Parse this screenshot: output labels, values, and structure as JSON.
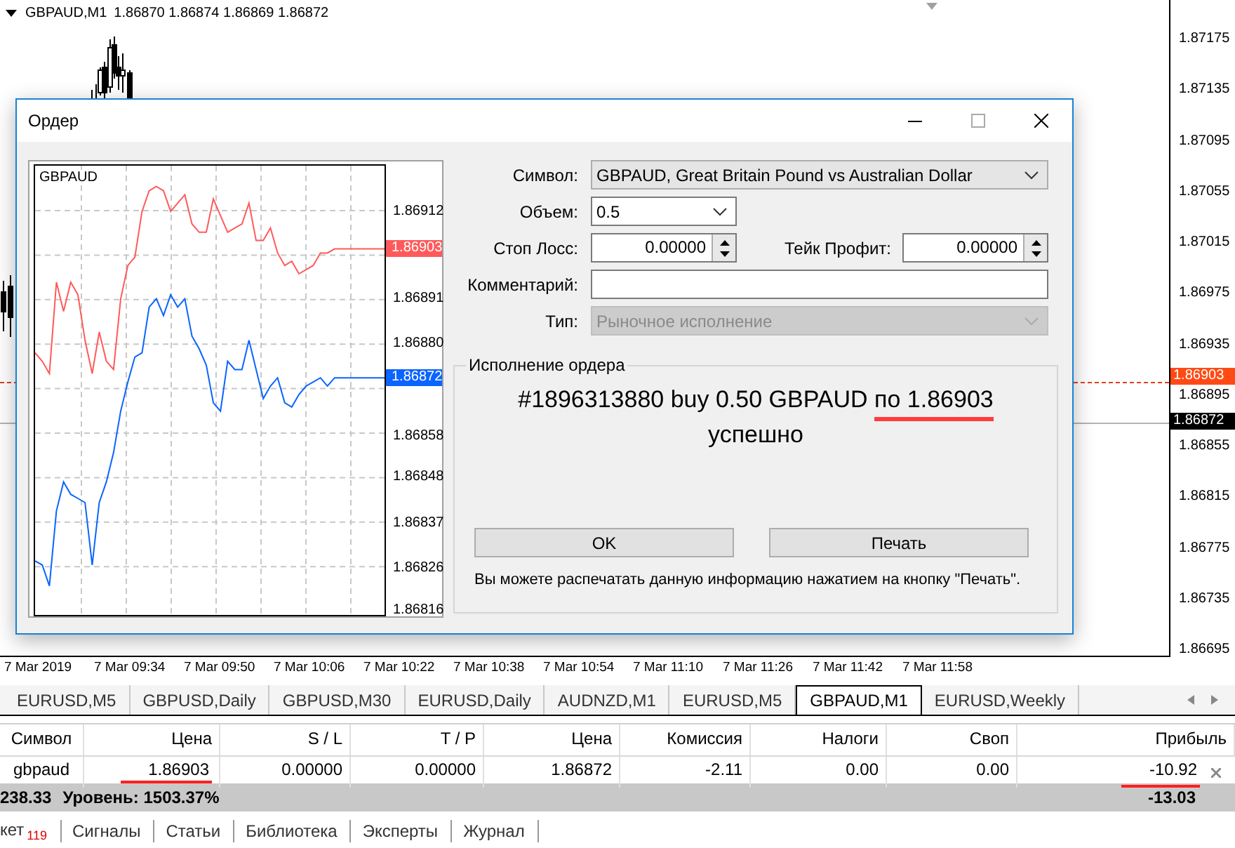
{
  "chart": {
    "symbol": "GBPAUD,M1",
    "ohlc": "1.86870 1.86874 1.86869 1.86872",
    "price_axis": [
      {
        "kind": "tick",
        "text": "1.87175"
      },
      {
        "kind": "tick",
        "text": "1.87135"
      },
      {
        "kind": "tick",
        "text": "1.87095"
      },
      {
        "kind": "tick",
        "text": "1.87055"
      },
      {
        "kind": "tick",
        "text": "1.87015"
      },
      {
        "kind": "tick",
        "text": "1.86975"
      },
      {
        "kind": "tick",
        "text": "1.86935"
      },
      {
        "kind": "ask",
        "text": "1.86903"
      },
      {
        "kind": "tick",
        "text": "1.86895"
      },
      {
        "kind": "bid",
        "text": "1.86872"
      },
      {
        "kind": "tick",
        "text": "1.86855"
      },
      {
        "kind": "tick",
        "text": "1.86815"
      },
      {
        "kind": "tick",
        "text": "1.86775"
      },
      {
        "kind": "tick",
        "text": "1.86735"
      },
      {
        "kind": "tick",
        "text": "1.86695"
      }
    ],
    "time_axis": [
      "7 Mar 2019",
      "7 Mar 09:34",
      "7 Mar 09:50",
      "7 Mar 10:06",
      "7 Mar 10:22",
      "7 Mar 10:38",
      "7 Mar 10:54",
      "7 Mar 11:10",
      "7 Mar 11:26",
      "7 Mar 11:42",
      "7 Mar 11:58"
    ]
  },
  "dialog": {
    "title": "Ордер",
    "mini_chart": {
      "symbol": "GBPAUD",
      "ask_tag": "1.86903",
      "bid_tag": "1.86872",
      "chart_data": {
        "type": "line",
        "grid": true,
        "ylim": [
          1.86815,
          1.86923
        ],
        "yticks": [
          {
            "value": 1.86912,
            "label": "1.86912"
          },
          {
            "value": 1.86891,
            "label": "1.86891"
          },
          {
            "value": 1.8688,
            "label": "1.86880"
          },
          {
            "value": 1.86858,
            "label": "1.86858"
          },
          {
            "value": 1.86848,
            "label": "1.86848"
          },
          {
            "value": 1.86837,
            "label": "1.86837"
          },
          {
            "value": 1.86826,
            "label": "1.86826"
          },
          {
            "value": 1.86816,
            "label": "1.86816"
          }
        ],
        "series": [
          {
            "color": "#ff5a5a",
            "values": [
              1.86878,
              1.86876,
              1.86873,
              1.86895,
              1.86888,
              1.86895,
              1.86892,
              1.86881,
              1.86873,
              1.86883,
              1.86876,
              1.86874,
              1.86891,
              1.86899,
              1.86901,
              1.86912,
              1.86917,
              1.86918,
              1.86917,
              1.86912,
              1.86914,
              1.86916,
              1.86909,
              1.86907,
              1.86907,
              1.86915,
              1.86911,
              1.86907,
              1.86908,
              1.86909,
              1.86914,
              1.86905,
              1.86905,
              1.86908,
              1.86902,
              1.86899,
              1.869,
              1.86897,
              1.86898,
              1.86899,
              1.86902,
              1.86902,
              1.86903,
              1.86903,
              1.86903,
              1.86903,
              1.86903,
              1.86903,
              1.86903,
              1.86903
            ]
          },
          {
            "color": "#0a64ff",
            "values": [
              1.86828,
              1.86827,
              1.86822,
              1.8684,
              1.86847,
              1.86844,
              1.86843,
              1.86842,
              1.86827,
              1.86842,
              1.86847,
              1.86854,
              1.86864,
              1.86871,
              1.86877,
              1.86878,
              1.86889,
              1.86891,
              1.86887,
              1.86892,
              1.86889,
              1.86891,
              1.86882,
              1.86879,
              1.86875,
              1.86866,
              1.86864,
              1.86876,
              1.86874,
              1.86874,
              1.86881,
              1.86874,
              1.86867,
              1.8687,
              1.86872,
              1.86866,
              1.86865,
              1.86868,
              1.8687,
              1.86871,
              1.86872,
              1.8687,
              1.86872,
              1.86872,
              1.86872,
              1.86872,
              1.86872,
              1.86872,
              1.86872,
              1.86872
            ]
          }
        ]
      }
    },
    "form": {
      "symbol": {
        "label": "Символ:",
        "value": "GBPAUD, Great Britain Pound vs Australian Dollar"
      },
      "volume": {
        "label": "Объем:",
        "value": "0.5"
      },
      "stop_loss": {
        "label": "Стоп Лосс:",
        "value": "0.00000"
      },
      "take_profit": {
        "label": "Тейк Профит:",
        "value": "0.00000"
      },
      "comment": {
        "label": "Комментарий:"
      },
      "type": {
        "label": "Тип:",
        "value": "Рыночное исполнение",
        "disabled": true
      }
    },
    "execution": {
      "legend": "Исполнение ордера",
      "message_parts": [
        {
          "text": "#1896313880 buy 0.50 GBPAUD ",
          "underlined": false
        },
        {
          "text": "по 1.86903",
          "underlined": true
        }
      ],
      "status": "успешно",
      "buttons": [
        "OK",
        "Печать"
      ],
      "note": "Вы можете распечатать данную информацию нажатием на кнопку \"Печать\"."
    }
  },
  "tabs": [
    {
      "label": "EURUSD,M5",
      "selected": false
    },
    {
      "label": "GBPUSD,Daily",
      "selected": false
    },
    {
      "label": "GBPUSD,M30",
      "selected": false
    },
    {
      "label": "EURUSD,Daily",
      "selected": false
    },
    {
      "label": "AUDNZD,M1",
      "selected": false
    },
    {
      "label": "EURUSD,M5",
      "selected": false
    },
    {
      "label": "GBPAUD,M1",
      "selected": true
    },
    {
      "label": "EURUSD,Weekly",
      "selected": false
    }
  ],
  "table": {
    "columns": [
      "Символ",
      "Цена",
      "S / L",
      "T / P",
      "Цена",
      "Комиссия",
      "Налоги",
      "Своп",
      "Прибыль"
    ],
    "rows": [
      {
        "cells": [
          {
            "text": "gbpaud",
            "underlined": false
          },
          {
            "text": "1.86903",
            "underlined": true
          },
          {
            "text": "0.00000",
            "underlined": false
          },
          {
            "text": "0.00000",
            "underlined": false
          },
          {
            "text": "1.86872",
            "underlined": false
          },
          {
            "text": "-2.11",
            "underlined": false
          },
          {
            "text": "0.00",
            "underlined": false
          },
          {
            "text": "0.00",
            "underlined": false
          },
          {
            "text": "-10.92",
            "underlined": true
          }
        ]
      }
    ],
    "summary": {
      "balance": "238.33",
      "margin_level": "Уровень: 1503.37%",
      "total": "-13.03"
    }
  },
  "bottom_tabs": [
    {
      "label": "кет",
      "badge": "119"
    },
    {
      "label": "Сигналы"
    },
    {
      "label": "Статьи"
    },
    {
      "label": "Библиотека"
    },
    {
      "label": "Эксперты"
    },
    {
      "label": "Журнал"
    }
  ]
}
